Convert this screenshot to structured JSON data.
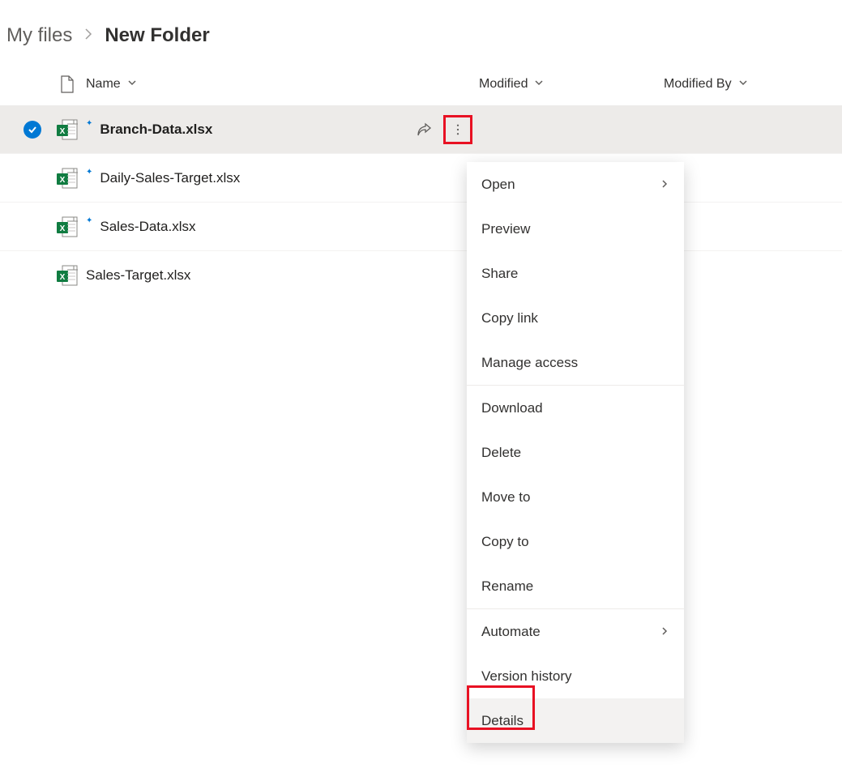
{
  "breadcrumb": {
    "prev": "My files",
    "current": "New Folder"
  },
  "columns": {
    "name": "Name",
    "modified": "Modified",
    "modified_by": "Modified By"
  },
  "files": [
    {
      "name": "Branch-Data.xlsx",
      "selected": true,
      "new": true
    },
    {
      "name": "Daily-Sales-Target.xlsx",
      "selected": false,
      "new": true
    },
    {
      "name": "Sales-Data.xlsx",
      "selected": false,
      "new": true
    },
    {
      "name": "Sales-Target.xlsx",
      "selected": false,
      "new": false
    }
  ],
  "context_menu": {
    "open": "Open",
    "preview": "Preview",
    "share": "Share",
    "copy_link": "Copy link",
    "manage_access": "Manage access",
    "download": "Download",
    "delete": "Delete",
    "move_to": "Move to",
    "copy_to": "Copy to",
    "rename": "Rename",
    "automate": "Automate",
    "version_history": "Version history",
    "details": "Details"
  }
}
